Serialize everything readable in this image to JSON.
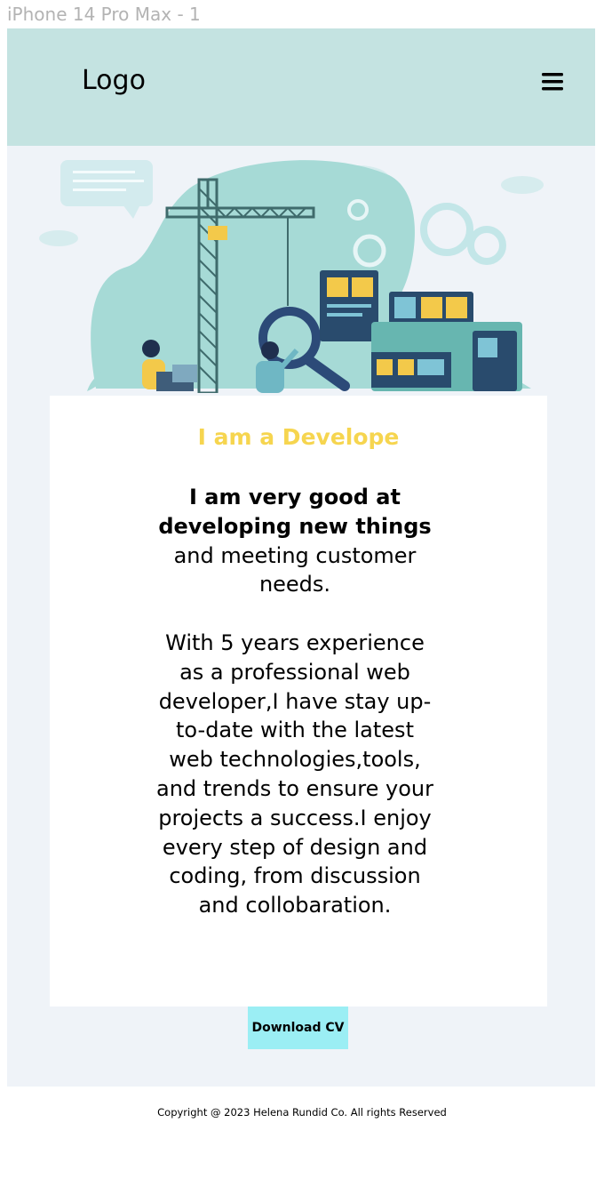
{
  "frame": {
    "label": "iPhone 14 Pro Max - 1"
  },
  "colors": {
    "page_background": "#eff3f8",
    "header_background": "#c4e3e1",
    "accent_yellow": "#f6d54f",
    "button_background": "#9beef4",
    "card_background": "#ffffff"
  },
  "header": {
    "logo_text": "Logo",
    "menu_icon": "hamburger-menu-icon"
  },
  "hero": {
    "illustration": "developer-workspace-illustration"
  },
  "intro": {
    "subtitle": "I am a Develope",
    "line1_bold": "I am very good at developing new things",
    "line1_rest": "and meeting customer needs.",
    "paragraph": "With 5 years experience as a professional web developer,I have stay up-to-date with the latest web technologies,tools, and trends to ensure your projects a success.I enjoy every step of design and coding, from discussion and collobaration."
  },
  "actions": {
    "download_cv_label": "Download CV"
  },
  "footer": {
    "copyright": "Copyright @ 2023 Helena Rundid Co. All rights Reserved"
  }
}
